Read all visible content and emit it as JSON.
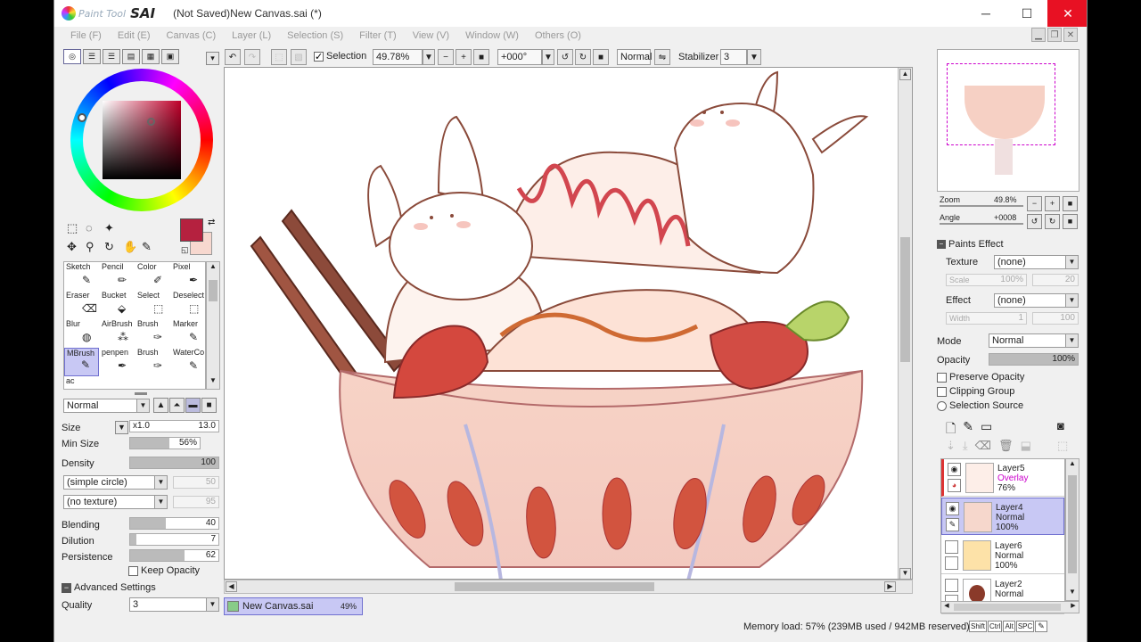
{
  "app": {
    "logo_text": "Paint Tool",
    "logo_sai": "SAI",
    "title": "(Not Saved)New Canvas.sai (*)"
  },
  "menu": [
    "File (F)",
    "Edit (E)",
    "Canvas (C)",
    "Layer (L)",
    "Selection (S)",
    "Filter (T)",
    "View (V)",
    "Window (W)",
    "Others (O)"
  ],
  "toolbar": {
    "selection_label": "Selection",
    "zoom": "49.78%",
    "angle": "+000°",
    "blend": "Normal",
    "stabilizer_label": "Stabilizer",
    "stabilizer_value": "3"
  },
  "colors": {
    "primary": "#b5213f",
    "secondary": "#f7d8cf",
    "accent": "#c8c8f4"
  },
  "tools": [
    {
      "label": "Sketch"
    },
    {
      "label": "Pencil"
    },
    {
      "label": "Color"
    },
    {
      "label": "Pixel"
    },
    {
      "label": "Eraser"
    },
    {
      "label": "Bucket"
    },
    {
      "label": "Select"
    },
    {
      "label": "Deselect"
    },
    {
      "label": "Blur"
    },
    {
      "label": "AirBrush"
    },
    {
      "label": "Brush"
    },
    {
      "label": "Marker"
    },
    {
      "label": "MBrush"
    },
    {
      "label": "penpen"
    },
    {
      "label": "Brush"
    },
    {
      "label": "WaterCo"
    },
    {
      "label": "ac"
    }
  ],
  "brush": {
    "blend_mode": "Normal",
    "size_label": "Size",
    "size_mult": "x1.0",
    "size_value": "13.0",
    "minsize_label": "Min Size",
    "minsize_value": "56%",
    "minsize_pct": 56,
    "density_label": "Density",
    "density_value": "100",
    "density_pct": 100,
    "shape": "(simple circle)",
    "shape_value": "50",
    "texture": "(no texture)",
    "texture_value": "95",
    "blending_label": "Blending",
    "blending_value": "40",
    "blending_pct": 40,
    "dilution_label": "Dilution",
    "dilution_value": "7",
    "dilution_pct": 7,
    "persistence_label": "Persistence",
    "persistence_value": "62",
    "persistence_pct": 62,
    "keep_opacity": "Keep Opacity",
    "advanced": "Advanced Settings",
    "quality_label": "Quality",
    "quality_value": "3"
  },
  "canvas_tab": {
    "name": "New Canvas.sai",
    "zoom": "49%"
  },
  "status": {
    "memory": "Memory load: 57% (239MB used / 942MB reserved)",
    "keys": [
      "Shift",
      "Ctrl",
      "Alt",
      "SPC"
    ]
  },
  "navigator": {
    "zoom_label": "Zoom",
    "zoom_value": "49.8%",
    "angle_label": "Angle",
    "angle_value": "+0008"
  },
  "paints_effect": {
    "header": "Paints Effect",
    "texture_label": "Texture",
    "texture_value": "(none)",
    "scale_label": "Scale",
    "scale_value": "100%",
    "scale_num": "20",
    "effect_label": "Effect",
    "effect_value": "(none)",
    "width_label": "Width",
    "width_value": "1",
    "width_num": "100"
  },
  "layer_props": {
    "mode_label": "Mode",
    "mode_value": "Normal",
    "opacity_label": "Opacity",
    "opacity_value": "100%",
    "preserve": "Preserve Opacity",
    "clipping": "Clipping Group",
    "selsource": "Selection Source"
  },
  "layers": [
    {
      "name": "Layer5",
      "mode": "Overlay",
      "opacity": "76%"
    },
    {
      "name": "Layer4",
      "mode": "Normal",
      "opacity": "100%"
    },
    {
      "name": "Layer6",
      "mode": "Normal",
      "opacity": "100%"
    },
    {
      "name": "Layer2",
      "mode": "Normal",
      "opacity": ""
    }
  ]
}
